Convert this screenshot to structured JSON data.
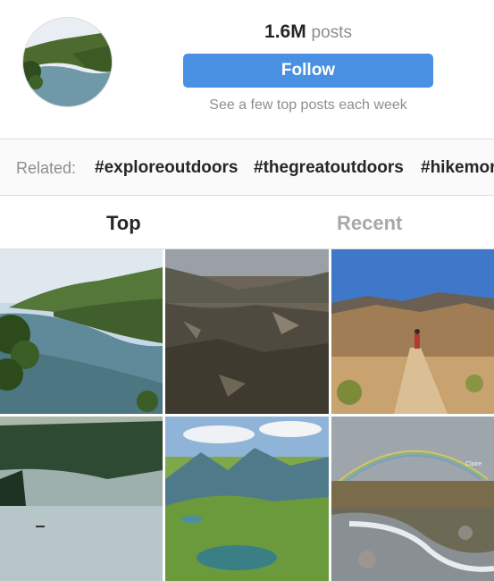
{
  "profile": {
    "post_count": "1.6M",
    "post_unit": "posts",
    "follow_label": "Follow",
    "subtitle": "See a few top posts each week"
  },
  "related": {
    "label": "Related:",
    "tags": [
      "#exploreoutdoors",
      "#thegreatoutdoors",
      "#hikemor"
    ]
  },
  "tabs": {
    "top_label": "Top",
    "recent_label": "Recent"
  },
  "posts": [
    {
      "name": "coastal-cliffs-photo"
    },
    {
      "name": "rocky-valley-photo"
    },
    {
      "name": "desert-hiker-photo"
    },
    {
      "name": "misty-lake-photo"
    },
    {
      "name": "alpine-lake-photo"
    },
    {
      "name": "rainbow-stream-photo",
      "watermark": "Claire"
    }
  ],
  "colors": {
    "accent": "#4a90e2",
    "muted_text": "#8e8e8e",
    "border": "#dbdbdb"
  }
}
